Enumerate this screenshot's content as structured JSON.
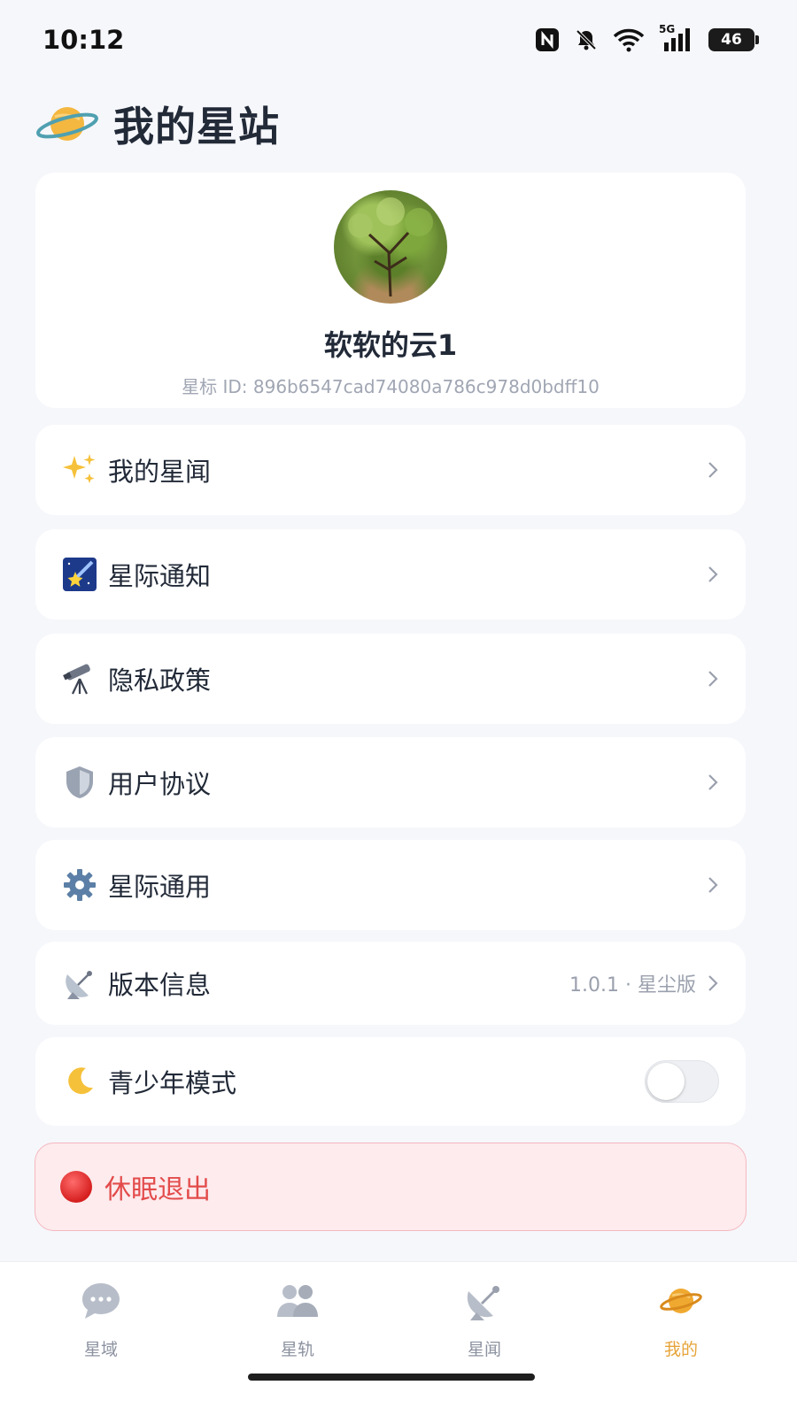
{
  "status_bar": {
    "time": "10:12",
    "network": "5G",
    "battery": "46",
    "icons": [
      "nfc-icon",
      "bell-muted-icon",
      "wifi-icon",
      "signal-icon",
      "battery-icon"
    ]
  },
  "header": {
    "icon": "planet-icon",
    "title": "我的星站"
  },
  "profile": {
    "name": "软软的云1",
    "id_text": "星标 ID: 896b6547cad74080a786c978d0bdff10"
  },
  "menu": [
    {
      "icon": "sparkles-icon",
      "label": "我的星闻"
    },
    {
      "icon": "shooting-star-icon",
      "label": "星际通知"
    },
    {
      "icon": "telescope-icon",
      "label": "隐私政策"
    },
    {
      "icon": "shield-icon",
      "label": "用户协议"
    },
    {
      "icon": "gear-icon",
      "label": "星际通用"
    },
    {
      "icon": "satellite-dish-icon",
      "label": "版本信息",
      "value": "1.0.1 · 星尘版"
    },
    {
      "icon": "moon-icon",
      "label": "青少年模式",
      "toggle_on": false
    }
  ],
  "logout": {
    "label": "休眠退出",
    "color": "#e34b4b"
  },
  "bottom_nav": [
    {
      "icon": "chat-bubble-icon",
      "label": "星域",
      "active": false
    },
    {
      "icon": "users-icon",
      "label": "星轨",
      "active": false
    },
    {
      "icon": "satellite-dish-icon",
      "label": "星闻",
      "active": false
    },
    {
      "icon": "planet-icon",
      "label": "我的",
      "active": true
    }
  ],
  "colors": {
    "accent": "#e7a43a",
    "danger": "#e34b4b",
    "background": "#f6f7fb"
  }
}
